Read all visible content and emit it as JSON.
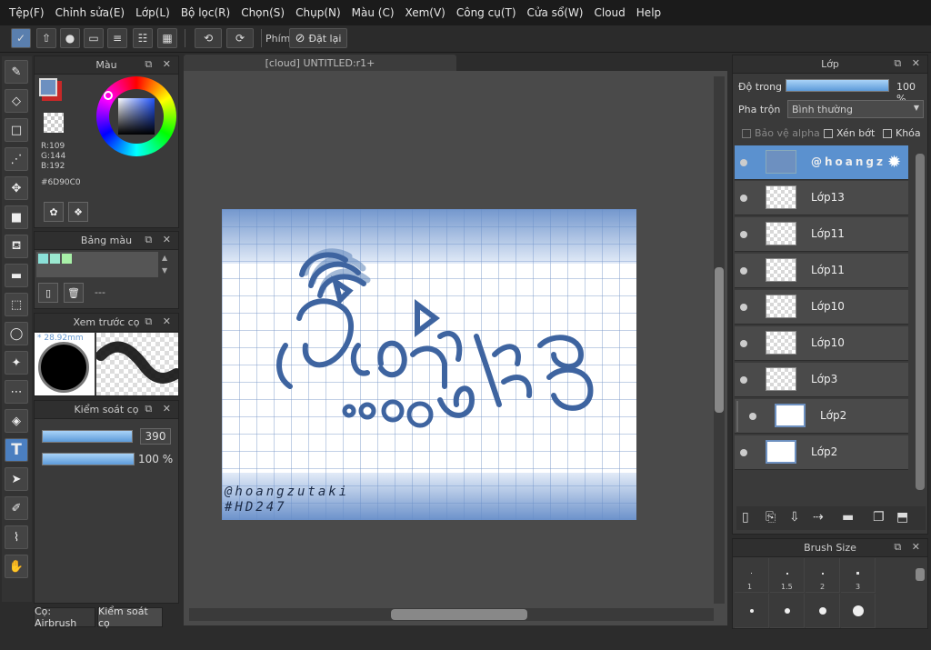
{
  "menu": [
    "Tệp(F)",
    "Chỉnh sửa(E)",
    "Lớp(L)",
    "Bộ lọc(R)",
    "Chọn(S)",
    "Chụp(N)",
    "Màu (C)",
    "Xem(V)",
    "Công cụ(T)",
    "Cửa sổ(W)",
    "Cloud",
    "Help"
  ],
  "toolbar": {
    "key_label": "Phím",
    "reset_label": "Đặt lại"
  },
  "color_panel": {
    "title": "Màu",
    "r": "R:109",
    "g": "G:144",
    "b": "B:192",
    "hex": "#6D90C0",
    "fg_color": "#6d90c0",
    "bg_color": "#c62828"
  },
  "palette_panel": {
    "title": "Bảng màu",
    "swatches": [
      "#8be0d8",
      "#9be8d0",
      "#a8f0a8"
    ],
    "dashes": "---"
  },
  "brush_preview": {
    "title": "Xem trước cọ",
    "size": "* 28.92mm"
  },
  "brush_control": {
    "title": "Kiểm soát cọ",
    "size": "390",
    "opacity": "100 %",
    "size_fill": 0.98,
    "opacity_fill": 1.0
  },
  "bottom_tabs": {
    "brush": "Cọ: Airbrush",
    "control": "Kiểm soát cọ"
  },
  "canvas": {
    "tab": "[cloud] UNTITLED:r1+",
    "signature_line1": "@hoangzutaki",
    "signature_line2": "#HD247"
  },
  "layer_panel": {
    "title": "Lớp",
    "opacity_label": "Độ trong",
    "opacity_value": "100 %",
    "opacity_fill": 1.0,
    "blend_label": "Pha trộn",
    "blend_value": "Bình thường",
    "protect_alpha": "Bảo vệ alpha",
    "clip": "Xén bớt",
    "lock": "Khóa",
    "layers": [
      {
        "name": "@hoangz",
        "selected": true
      },
      {
        "name": "Lớp13"
      },
      {
        "name": "Lớp11"
      },
      {
        "name": "Lớp11"
      },
      {
        "name": "Lớp10"
      },
      {
        "name": "Lớp10"
      },
      {
        "name": "Lớp3"
      },
      {
        "name": "Lớp2"
      },
      {
        "name": "Lớp2"
      }
    ]
  },
  "brush_size_panel": {
    "title": "Brush Size",
    "sizes": [
      "1",
      "1.5",
      "2",
      "3"
    ]
  },
  "icons": [
    "brush-icon",
    "eraser-icon",
    "select-rect-icon",
    "move-icon",
    "fill-icon",
    "text-icon",
    "hand-icon",
    "undo-icon",
    "redo-icon",
    "eye-icon"
  ]
}
